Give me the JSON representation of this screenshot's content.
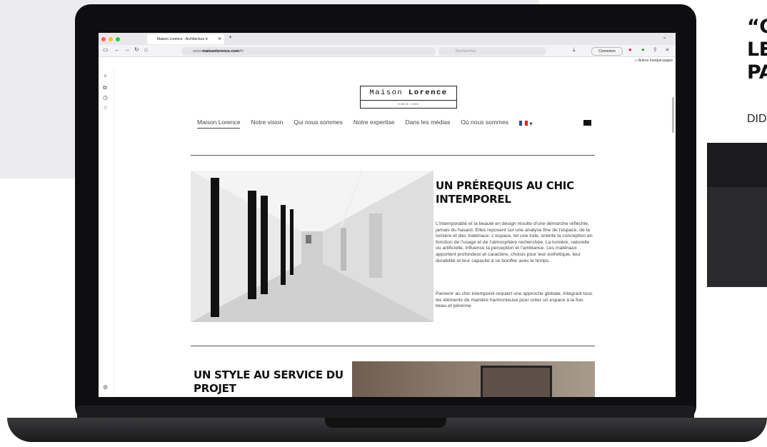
{
  "browser": {
    "tab_title": "Maison Lorence - Architecture d",
    "url_prefix": "www.",
    "url_domain": "maisonlorence.com",
    "url_path": "/fr/",
    "search_placeholder": "Rechercher",
    "connexion_label": "Connexion",
    "bookmarks_label": "Autres marque-pages"
  },
  "site": {
    "logo_light": "Maison ",
    "logo_bold": "Lorence",
    "logo_since": "SINCE 1996",
    "nav": [
      "Maison Lorence",
      "Notre vision",
      "Qui nous sommes",
      "Notre expertise",
      "Dans les médias",
      "Où nous sommes"
    ],
    "section1": {
      "title": "UN PRÉREQUIS AU CHIC INTEMPOREL",
      "p1": "L'intemporalité et la beauté en design résulte d'une démarche réfléchie, jamais du hasard. Elles reposent sur une analyse fine de l'espace, de la lumière et des matériaux. L'espace, tel une toile, oriente la conception en fonction de l'usage et de l'atmosphère recherchée. La lumière, naturelle ou artificielle, influence la perception et l'ambiance. Les matériaux apportent profondeur et caractère, choisis pour leur esthétique, leur durabilité et leur capacité à se bonifier avec le temps.",
      "p2": "Parvenir au chic intemporel requiert une approche globale, intégrant tous les éléments de manière harmonieuse pour créer un espace à la fois beau et pérenne."
    },
    "section2": {
      "title": "UN STYLE AU SERVICE DU PROJET"
    }
  },
  "outside": {
    "headline": "“C\nLE\nPA",
    "sub": "DID"
  }
}
